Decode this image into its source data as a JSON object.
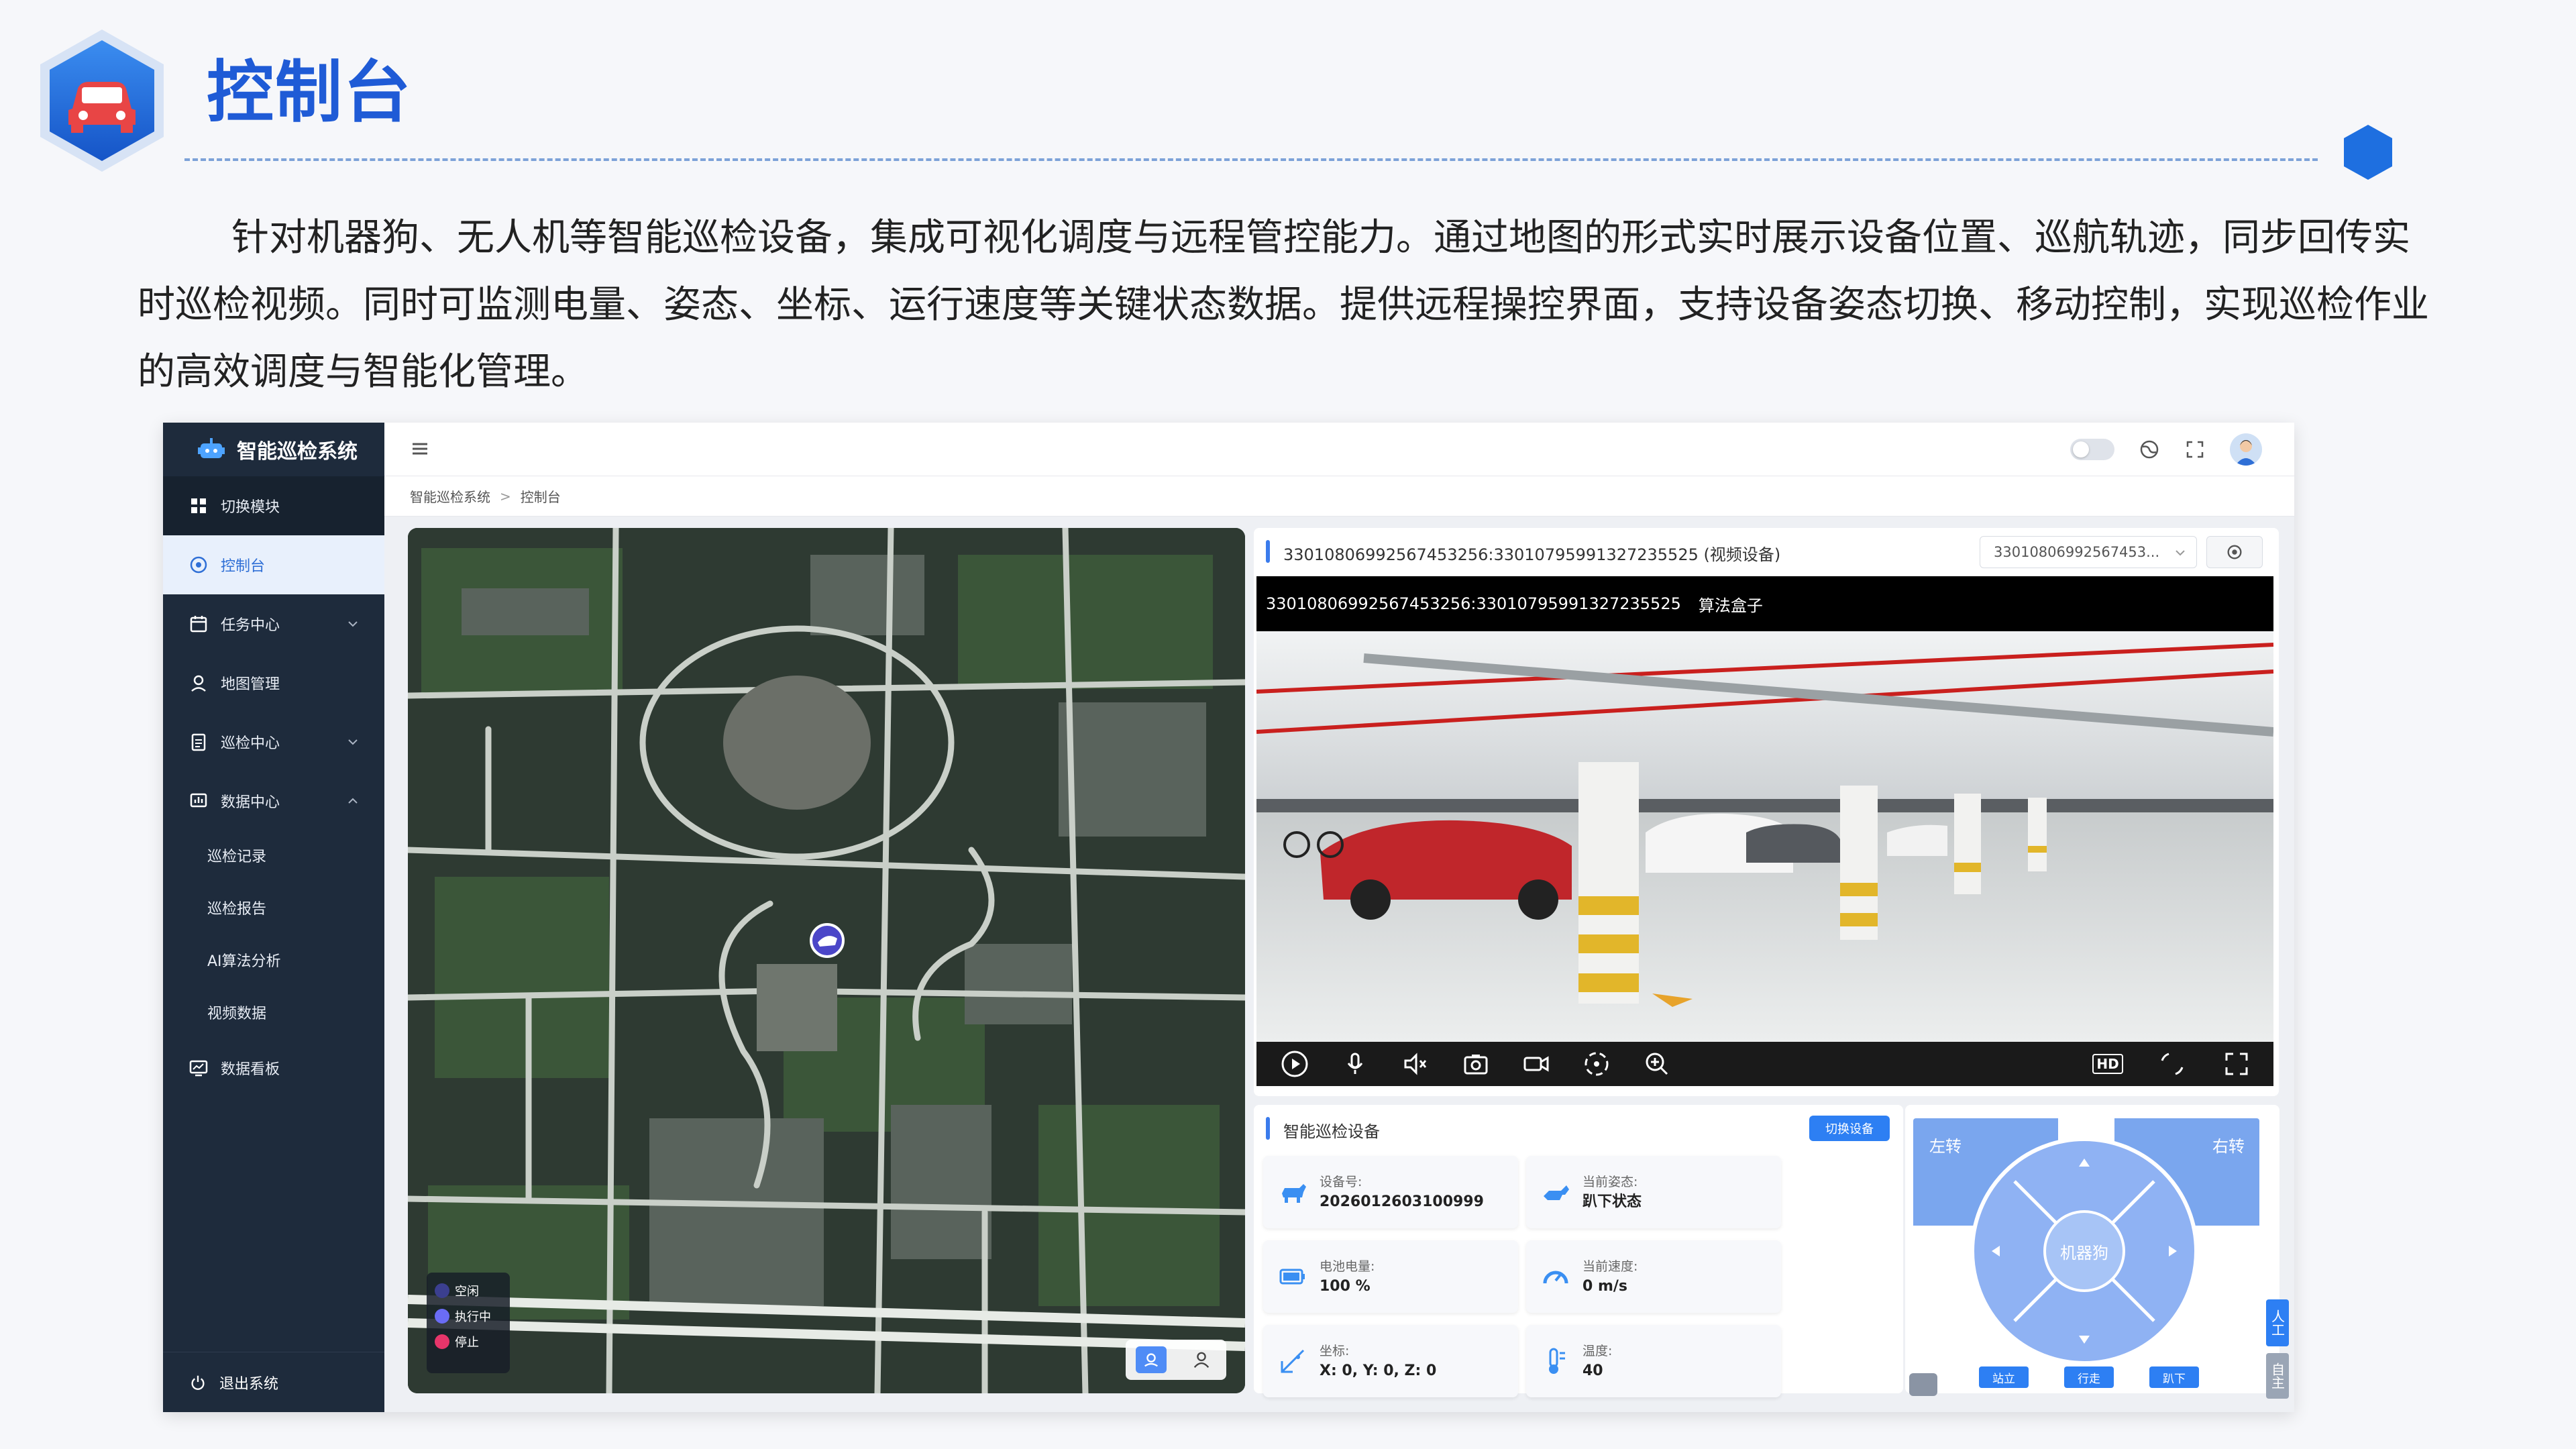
{
  "page": {
    "title": "控制台",
    "intro": "针对机器狗、无人机等智能巡检设备，集成可视化调度与远程管控能力。通过地图的形式实时展示设备位置、巡航轨迹，同步回传实时巡检视频。同时可监测电量、姿态、坐标、运行速度等关键状态数据。提供远程操控界面，支持设备姿态切换、移动控制，实现巡检作业的高效调度与智能化管理。"
  },
  "colors": {
    "accent": "#2d7ff3",
    "title": "#1f5bd6",
    "sidebar": "#1e2b3c",
    "active_bg": "#e8f0fc"
  },
  "app": {
    "brand": "智能巡检系统",
    "sidebar": [
      {
        "label": "切换模块",
        "icon": "grid-icon"
      },
      {
        "label": "控制台",
        "icon": "dashboard-icon",
        "active": true
      },
      {
        "label": "任务中心",
        "icon": "calendar-icon",
        "chevron": "down"
      },
      {
        "label": "地图管理",
        "icon": "map-pin-icon"
      },
      {
        "label": "巡检中心",
        "icon": "clipboard-icon",
        "chevron": "down"
      },
      {
        "label": "数据中心",
        "icon": "chart-icon",
        "chevron": "up"
      },
      {
        "label": "巡检记录"
      },
      {
        "label": "巡检报告"
      },
      {
        "label": "AI算法分析"
      },
      {
        "label": "视频数据"
      },
      {
        "label": "数据看板",
        "icon": "monitor-icon"
      }
    ],
    "logout": "退出系统",
    "breadcrumb": [
      "智能巡检系统",
      "控制台"
    ],
    "map": {
      "legend": [
        {
          "label": "空闲",
          "color": "#3b3f8f"
        },
        {
          "label": "执行中",
          "color": "#6a6cf5"
        },
        {
          "label": "停止",
          "color": "#e7356a"
        }
      ]
    },
    "video": {
      "header_title": "33010806992567453256:33010795991327235525 (视频设备)",
      "select_value": "33010806992567453...",
      "stream_id": "33010806992567453256:33010795991327235525",
      "stream_tag": "算法盒子",
      "hd": "HD"
    },
    "device": {
      "title": "智能巡检设备",
      "switch_btn": "切换设备",
      "fields": [
        {
          "key": "设备号:",
          "value": "2026012603100999",
          "icon": "robot-dog-icon"
        },
        {
          "key": "当前姿态:",
          "value": "趴下状态",
          "icon": "pose-icon"
        },
        {
          "key": "电池电量:",
          "value": "100 %",
          "icon": "battery-icon"
        },
        {
          "key": "当前速度:",
          "value": "0 m/s",
          "icon": "speedometer-icon"
        },
        {
          "key": "坐标:",
          "value": "X: 0, Y: 0, Z: 0",
          "icon": "coordinate-icon"
        },
        {
          "key": "温度:",
          "value": "40",
          "icon": "thermometer-icon"
        }
      ]
    },
    "control": {
      "left": "左转",
      "right": "右转",
      "hub": "机器狗",
      "buttons": [
        "站立",
        "行走",
        "趴下"
      ],
      "tab_manual": "人工",
      "tab_auto": "自主"
    }
  }
}
